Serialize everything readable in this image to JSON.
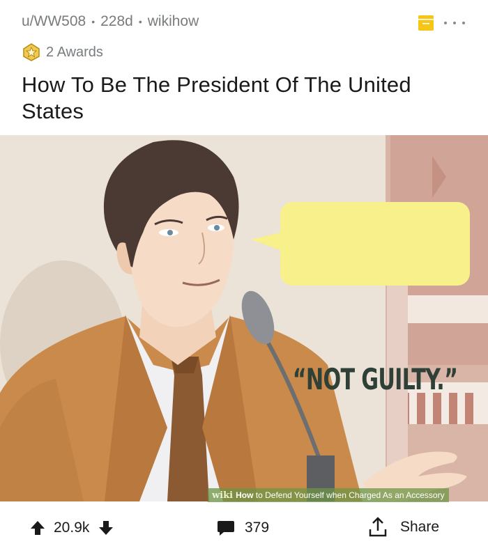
{
  "post": {
    "author": "u/WW508",
    "age": "228d",
    "domain": "wikihow",
    "awards_label": "2 Awards",
    "title": "How To Be The President Of The United States"
  },
  "image": {
    "speech_bubble": "“NOT GUILTY.”",
    "watermark_brand": "wiki",
    "watermark_how": "How",
    "watermark_text": "to Defend Yourself when Charged As an Accessory"
  },
  "footer": {
    "score": "20.9k",
    "comments": "379",
    "share_label": "Share"
  },
  "colors": {
    "meta": "#787c7e",
    "save_icon": "#f5c518",
    "bubble": "#f8f08a",
    "watermark": "#6e9646"
  },
  "icons": [
    "save-icon",
    "more-icon",
    "award-icon",
    "upvote-icon",
    "downvote-icon",
    "comment-icon",
    "share-icon"
  ]
}
